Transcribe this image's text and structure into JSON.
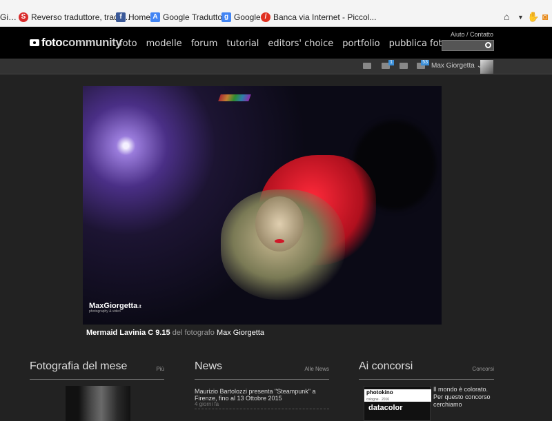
{
  "browser": {
    "bookmarks": [
      {
        "label": "Gi…",
        "icon": "page-icon",
        "color": "#888888"
      },
      {
        "label": "Reverso   traduttore, tradu...",
        "icon": "reverso-icon",
        "color": "#d92b2b"
      },
      {
        "label": "Home",
        "icon": "facebook-icon",
        "color": "#3b5998"
      },
      {
        "label": "Google Traduttore",
        "icon": "google-translate-icon",
        "color": "#4285f4"
      },
      {
        "label": "Google",
        "icon": "google-icon",
        "color": "#4285f4"
      },
      {
        "label": "Banca via Internet - Piccol...",
        "icon": "bank-icon",
        "color": "#e03020"
      }
    ]
  },
  "header": {
    "logo": {
      "part1": "foto",
      "part2": "community"
    },
    "nav": [
      "foto",
      "modelle",
      "forum",
      "tutorial",
      "editors' choice",
      "portfolio",
      "pubblica foto"
    ],
    "help_link": "Aiuto",
    "contact_link": "Contatto",
    "search": {
      "placeholder": ""
    }
  },
  "user_bar": {
    "messages_badge": "1",
    "notifications_badge": "53",
    "user_name": "Max Giorgetta"
  },
  "photo": {
    "watermark": "MaxGiorgetta",
    "watermark_suffix": ".it",
    "watermark_sub": "photography & video",
    "caption_title": "Mermaid Lavinia C 9.15",
    "caption_by": "del fotografo",
    "caption_author": "Max Giorgetta"
  },
  "sections": {
    "potm": {
      "title": "Fotografia del mese",
      "more": "Più"
    },
    "news": {
      "title": "News",
      "more": "Alle News",
      "item": "Maurizio Bartolozzi presenta \"Steampunk\" a Firenze, fino al 13 Ottobre 2015",
      "date": "4 giorni fa"
    },
    "contests": {
      "title": "Ai concorsi",
      "more": "Concorsi",
      "ad_brand1": "photokino",
      "ad_brand1_sub": "cologne · 2016",
      "ad_brand2": "datacolor",
      "text": "Il mondo è colorato. Per questo concorso cerchiamo"
    }
  }
}
